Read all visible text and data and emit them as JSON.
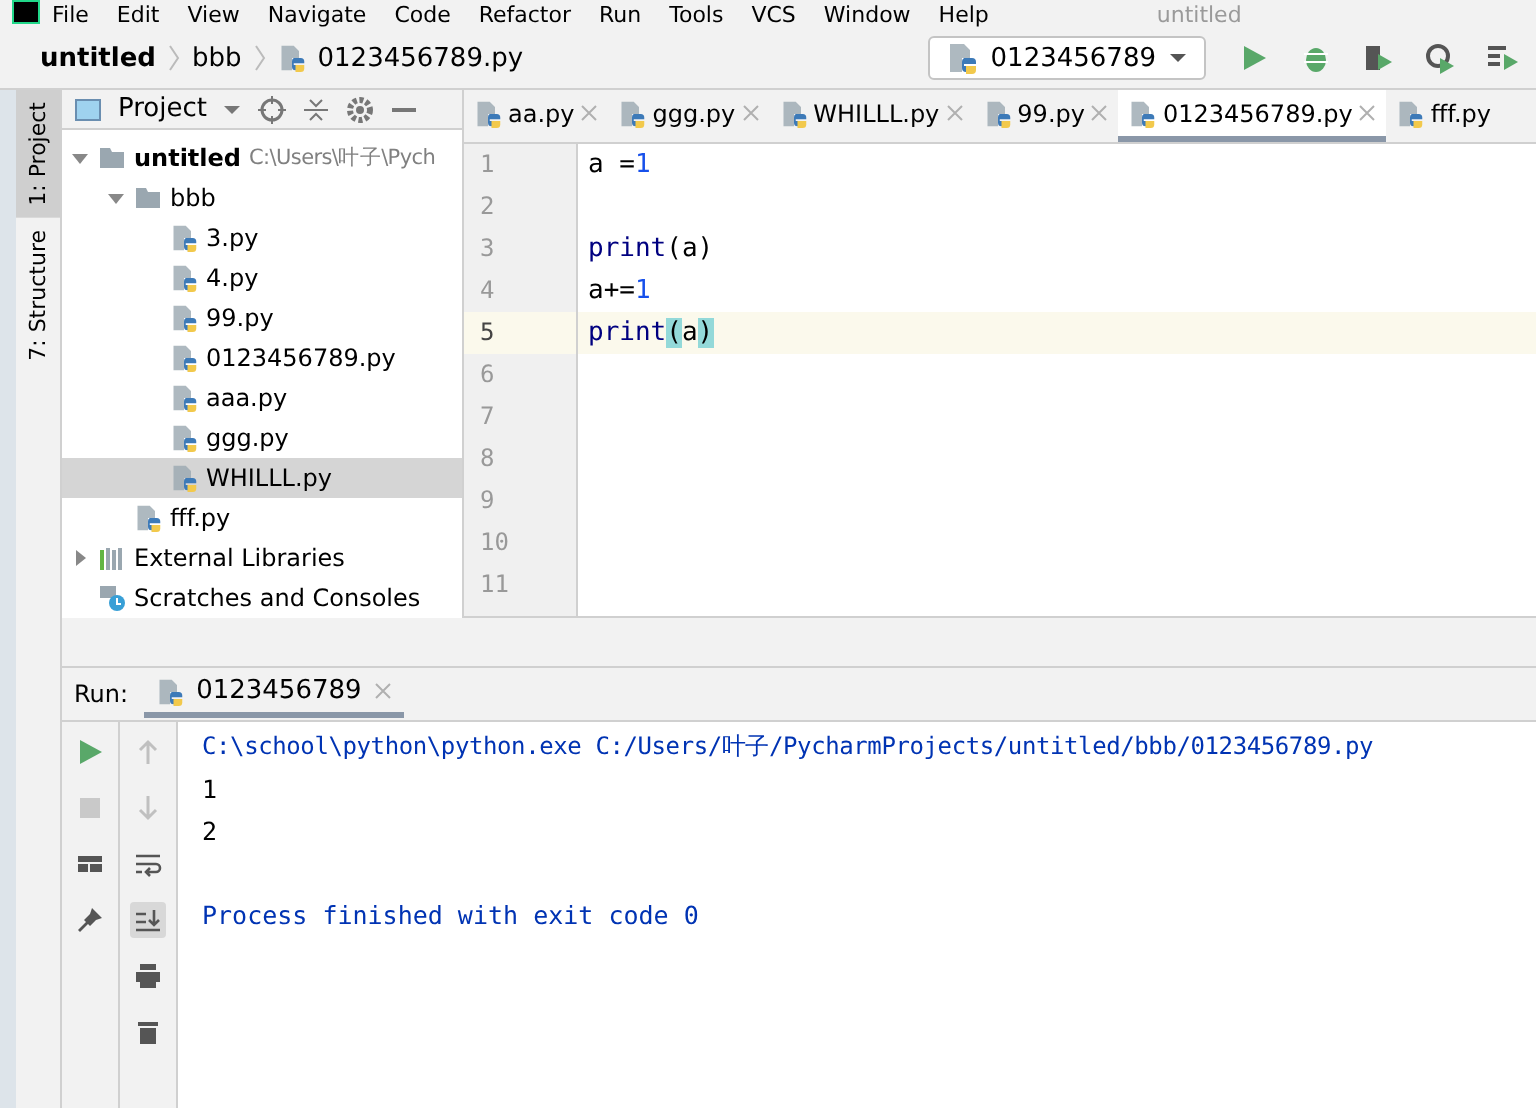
{
  "menu_bar": {
    "items": [
      "File",
      "Edit",
      "View",
      "Navigate",
      "Code",
      "Refactor",
      "Run",
      "Tools",
      "VCS",
      "Window",
      "Help"
    ],
    "title": "untitled"
  },
  "breadcrumbs": [
    "untitled",
    "bbb",
    "0123456789.py"
  ],
  "run_config": {
    "label": "0123456789"
  },
  "side_strip": [
    {
      "label": "1: Project",
      "selected": true
    },
    {
      "label": "7: Structure",
      "selected": false
    }
  ],
  "project_panel": {
    "title": "Project",
    "tree": [
      {
        "label": "untitled",
        "kind": "folder",
        "path": "C:\\Users\\叶子\\Pych",
        "expanded": true,
        "selected": false,
        "children": [
          {
            "label": "bbb",
            "kind": "folder",
            "expanded": true,
            "selected": false,
            "children": [
              {
                "label": "3.py",
                "kind": "python",
                "selected": false
              },
              {
                "label": "4.py",
                "kind": "python",
                "selected": false
              },
              {
                "label": "99.py",
                "kind": "python",
                "selected": false
              },
              {
                "label": "0123456789.py",
                "kind": "python",
                "selected": false
              },
              {
                "label": "aaa.py",
                "kind": "python",
                "selected": false
              },
              {
                "label": "ggg.py",
                "kind": "python",
                "selected": false
              },
              {
                "label": "WHILLL.py",
                "kind": "python",
                "selected": true
              }
            ]
          },
          {
            "label": "fff.py",
            "kind": "python",
            "selected": false
          }
        ]
      },
      {
        "label": "External Libraries",
        "kind": "library",
        "expanded": false,
        "selected": false
      },
      {
        "label": "Scratches and Consoles",
        "kind": "scratch",
        "selected": false
      }
    ]
  },
  "editor_tabs": [
    {
      "label": "aa.py",
      "selected": false
    },
    {
      "label": "ggg.py",
      "selected": false
    },
    {
      "label": "WHILLL.py",
      "selected": false
    },
    {
      "label": "99.py",
      "selected": false
    },
    {
      "label": "0123456789.py",
      "selected": true
    },
    {
      "label": "fff.py",
      "selected": false
    }
  ],
  "editor": {
    "lines": [
      {
        "number": "1",
        "current": false,
        "tokens": [
          {
            "text": "a =",
            "kind": "plain"
          },
          {
            "text": "1",
            "kind": "number"
          }
        ]
      },
      {
        "number": "2",
        "current": false
      },
      {
        "number": "3",
        "current": false,
        "tokens": [
          {
            "text": "print",
            "kind": "builtin"
          },
          {
            "text": "(a)",
            "kind": "plain"
          }
        ]
      },
      {
        "number": "4",
        "current": false,
        "tokens": [
          {
            "text": "a+=",
            "kind": "plain"
          },
          {
            "text": "1",
            "kind": "number"
          }
        ]
      },
      {
        "number": "5",
        "current": true,
        "tokens": [
          {
            "text": "print",
            "kind": "builtin"
          },
          {
            "text": "(",
            "kind": "match"
          },
          {
            "text": "a",
            "kind": "plain"
          },
          {
            "text": ")",
            "kind": "match"
          }
        ]
      },
      {
        "number": "6",
        "current": false
      },
      {
        "number": "7",
        "current": false
      },
      {
        "number": "8",
        "current": false
      },
      {
        "number": "9",
        "current": false
      },
      {
        "number": "10",
        "current": false
      },
      {
        "number": "11",
        "current": false
      }
    ]
  },
  "run_panel": {
    "label": "Run:",
    "tab": "0123456789",
    "scroll_to_end": true,
    "console": [
      {
        "text": "C:\\school\\python\\python.exe C:/Users/叶子/PycharmProjects/untitled/bbb/0123456789.py",
        "kind": "command"
      },
      {
        "text": "1",
        "kind": "output"
      },
      {
        "text": "2",
        "kind": "output"
      },
      {
        "text": "Process finished with exit code 0",
        "kind": "status"
      }
    ]
  }
}
